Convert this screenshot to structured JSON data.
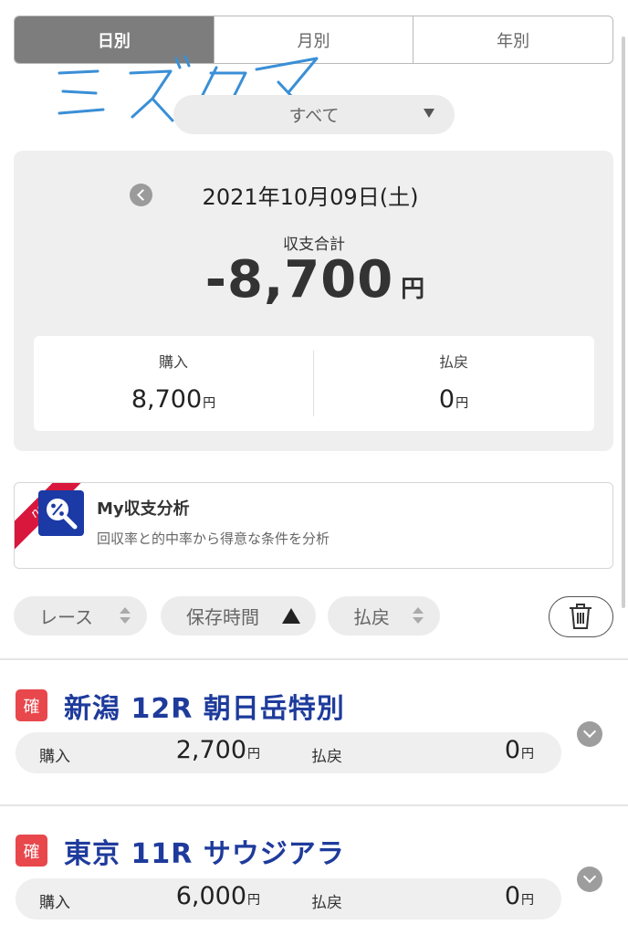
{
  "tabs": [
    {
      "label": "日別",
      "active": true
    },
    {
      "label": "月別",
      "active": false
    },
    {
      "label": "年別",
      "active": false
    }
  ],
  "watermark": "ミズクマ",
  "filter": {
    "selected": "すべて"
  },
  "summary": {
    "date": "2021年10月09日(土)",
    "total_label": "収支合計",
    "total_value": "-8,700",
    "total_unit": "円",
    "purchase_label": "購入",
    "purchase_value": "8,700",
    "payout_label": "払戻",
    "payout_value": "0",
    "unit": "円"
  },
  "analysis": {
    "badge": "new",
    "title": "My収支分析",
    "description": "回収率と的中率から得意な条件を分析"
  },
  "sort": {
    "race_label": "レース",
    "saved_time_label": "保存時間",
    "payout_label": "払戻"
  },
  "races": [
    {
      "badge": "確",
      "name": "新潟 12R 朝日岳特別",
      "purchase_label": "購入",
      "purchase": "2,700",
      "payout_label": "払戻",
      "payout": "0",
      "unit": "円"
    },
    {
      "badge": "確",
      "name": "東京 11R サウジアラ",
      "purchase_label": "購入",
      "purchase": "6,000",
      "payout_label": "払戻",
      "payout": "0",
      "unit": "円"
    }
  ],
  "colors": {
    "active_tab": "#7d7d7d",
    "race_title": "#1e3b9c",
    "kaku_badge": "#e8474c",
    "new_ribbon": "#d9163c",
    "watermark": "#3a8fd6"
  }
}
